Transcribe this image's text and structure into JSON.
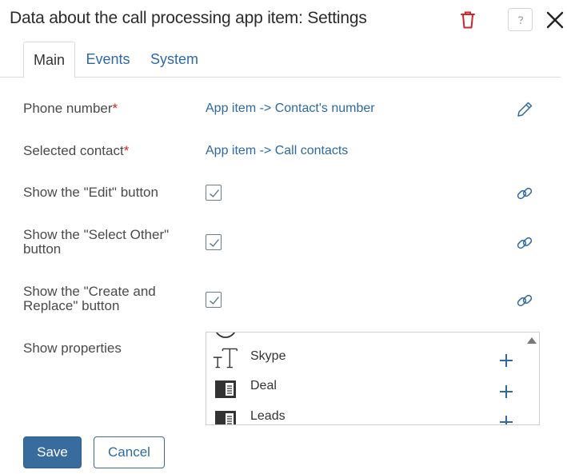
{
  "header": {
    "title": "Data about the call processing app item: Settings",
    "delete_icon": "trash-icon",
    "help_icon": "help-icon",
    "close_icon": "close-icon"
  },
  "tabs": [
    {
      "label": "Main",
      "active": true
    },
    {
      "label": "Events",
      "active": false
    },
    {
      "label": "System",
      "active": false
    }
  ],
  "fields": {
    "phone": {
      "label": "Phone number",
      "required_mark": "*",
      "value": "App item -> Contact's number"
    },
    "contact": {
      "label": "Selected contact",
      "required_mark": "*",
      "value": "App item -> Call contacts"
    },
    "edit": {
      "label": "Show the \"Edit\" button",
      "checked": true
    },
    "select_other": {
      "label_line1": "Show the \"Select Other\"",
      "label_line2": "button",
      "checked": true
    },
    "create_replace": {
      "label_line1": "Show the \"Create and",
      "label_line2": "Replace\" button",
      "checked": true
    },
    "properties": {
      "label": "Show properties"
    }
  },
  "properties_list": [
    {
      "label": "Skype",
      "icon": "text-type-icon"
    },
    {
      "label": "Deal",
      "icon": "app-card-icon"
    },
    {
      "label": "Leads",
      "icon": "app-card-icon"
    }
  ],
  "footer": {
    "save_label": "Save",
    "cancel_label": "Cancel"
  },
  "colors": {
    "link": "#2e6aa1",
    "primary_button": "#386b9e",
    "required": "#d0232b",
    "delete": "#d0232b"
  }
}
